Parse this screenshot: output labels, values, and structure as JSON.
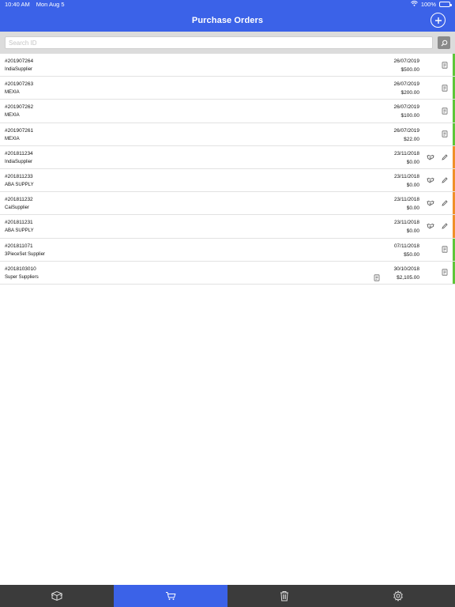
{
  "status": {
    "time": "10:40 AM",
    "date": "Mon Aug 5",
    "battery": "100%"
  },
  "nav": {
    "title": "Purchase Orders",
    "add_icon": "plus-circle-icon"
  },
  "search": {
    "placeholder": "Search ID",
    "value": ""
  },
  "colors": {
    "accent": "#3b62e8",
    "green": "#5ec639",
    "orange": "#f0902a",
    "tabbar": "#3b3b3b"
  },
  "orders": [
    {
      "id": "#201907264",
      "supplier": "IndiaSupplier",
      "date": "26/07/2019",
      "amount": "$500.00",
      "status": "green"
    },
    {
      "id": "#201907263",
      "supplier": "MEXIA",
      "date": "26/07/2019",
      "amount": "$200.00",
      "status": "green"
    },
    {
      "id": "#201907262",
      "supplier": "MEXIA",
      "date": "26/07/2019",
      "amount": "$100.00",
      "status": "green"
    },
    {
      "id": "#201907261",
      "supplier": "MEXIA",
      "date": "26/07/2019",
      "amount": "$22.00",
      "status": "green"
    },
    {
      "id": "#201811234",
      "supplier": "IndiaSupplier",
      "date": "23/11/2018",
      "amount": "$0.00",
      "status": "orange"
    },
    {
      "id": "#201811233",
      "supplier": "ABA SUPPLY",
      "date": "23/11/2018",
      "amount": "$0.00",
      "status": "orange"
    },
    {
      "id": "#201811232",
      "supplier": "CaiSupplier",
      "date": "23/11/2018",
      "amount": "$0.00",
      "status": "orange"
    },
    {
      "id": "#201811231",
      "supplier": "ABA SUPPLY",
      "date": "23/11/2018",
      "amount": "$0.00",
      "status": "orange"
    },
    {
      "id": "#201811071",
      "supplier": "3PieceSet Supplier",
      "date": "07/11/2018",
      "amount": "$50.00",
      "status": "green"
    },
    {
      "id": "#2018103010",
      "supplier": "Super Suppliers",
      "date": "30/10/2018",
      "amount": "$2,105.00",
      "status": "green"
    }
  ],
  "tabs": [
    {
      "icon": "box-icon"
    },
    {
      "icon": "cart-icon"
    },
    {
      "icon": "trash-icon"
    },
    {
      "icon": "gear-icon"
    }
  ]
}
